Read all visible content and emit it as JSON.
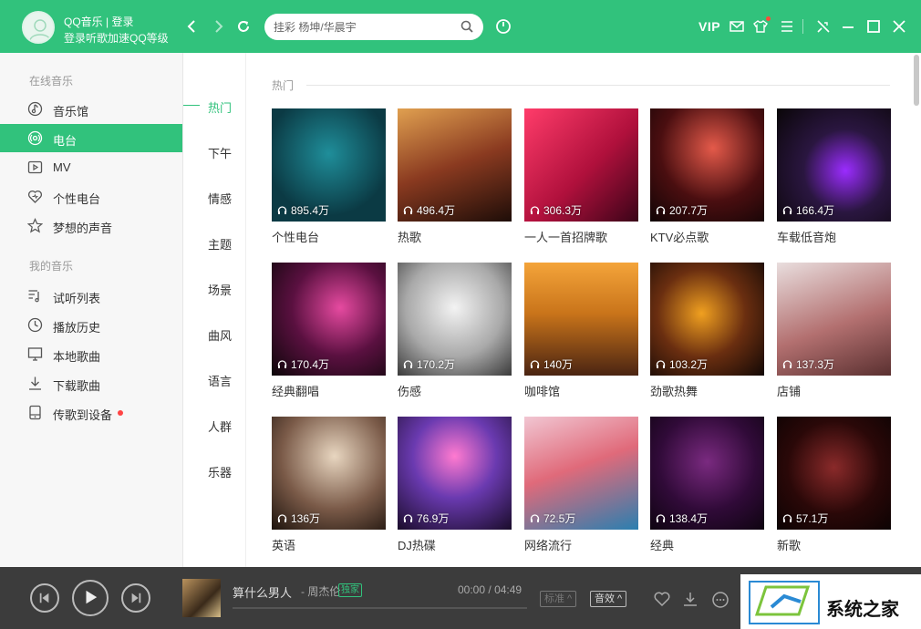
{
  "titlebar": {
    "app_login": "QQ音乐 | 登录",
    "login_hint": "登录听歌加速QQ等级",
    "search_placeholder": "挂彩 杨坤/华晨宇",
    "vip": "VIP"
  },
  "sidebar": {
    "online_title": "在线音乐",
    "online_items": [
      {
        "label": "音乐馆",
        "icon": "music-hall-icon"
      },
      {
        "label": "电台",
        "icon": "radio-icon",
        "active": true
      },
      {
        "label": "MV",
        "icon": "mv-icon"
      },
      {
        "label": "个性电台",
        "icon": "heart-radio-icon"
      },
      {
        "label": "梦想的声音",
        "icon": "star-icon"
      }
    ],
    "mine_title": "我的音乐",
    "mine_items": [
      {
        "label": "试听列表",
        "icon": "playlist-icon"
      },
      {
        "label": "播放历史",
        "icon": "clock-icon"
      },
      {
        "label": "本地歌曲",
        "icon": "monitor-icon"
      },
      {
        "label": "下载歌曲",
        "icon": "download-icon"
      },
      {
        "label": "传歌到设备",
        "icon": "device-icon",
        "badge": true
      }
    ]
  },
  "categories": [
    "热门",
    "下午",
    "情感",
    "主题",
    "场景",
    "曲风",
    "语言",
    "人群",
    "乐器"
  ],
  "active_category": "热门",
  "main": {
    "section_title": "热门",
    "cards": [
      {
        "title": "个性电台",
        "plays": "895.4万"
      },
      {
        "title": "热歌",
        "plays": "496.4万"
      },
      {
        "title": "一人一首招牌歌",
        "plays": "306.3万"
      },
      {
        "title": "KTV必点歌",
        "plays": "207.7万"
      },
      {
        "title": "车载低音炮",
        "plays": "166.4万"
      },
      {
        "title": "经典翻唱",
        "plays": "170.4万"
      },
      {
        "title": "伤感",
        "plays": "170.2万"
      },
      {
        "title": "咖啡馆",
        "plays": "140万"
      },
      {
        "title": "劲歌热舞",
        "plays": "103.2万"
      },
      {
        "title": "店铺",
        "plays": "137.3万"
      },
      {
        "title": "英语",
        "plays": "136万"
      },
      {
        "title": "DJ热碟",
        "plays": "76.9万"
      },
      {
        "title": "网络流行",
        "plays": "72.5万"
      },
      {
        "title": "经典",
        "plays": "138.4万"
      },
      {
        "title": "新歌",
        "plays": "57.1万"
      }
    ]
  },
  "player": {
    "song": "算什么男人",
    "artist": "- 周杰伦",
    "badge": "独家",
    "time_current": "00:00",
    "time_separator": "/",
    "time_total": "04:49",
    "progress": 0.0,
    "lyrics_label": "标准",
    "effect_label": "音效"
  },
  "watermark": "系统之家",
  "colors": {
    "accent": "#31c27c",
    "player_bg": "#3c3c3c"
  }
}
